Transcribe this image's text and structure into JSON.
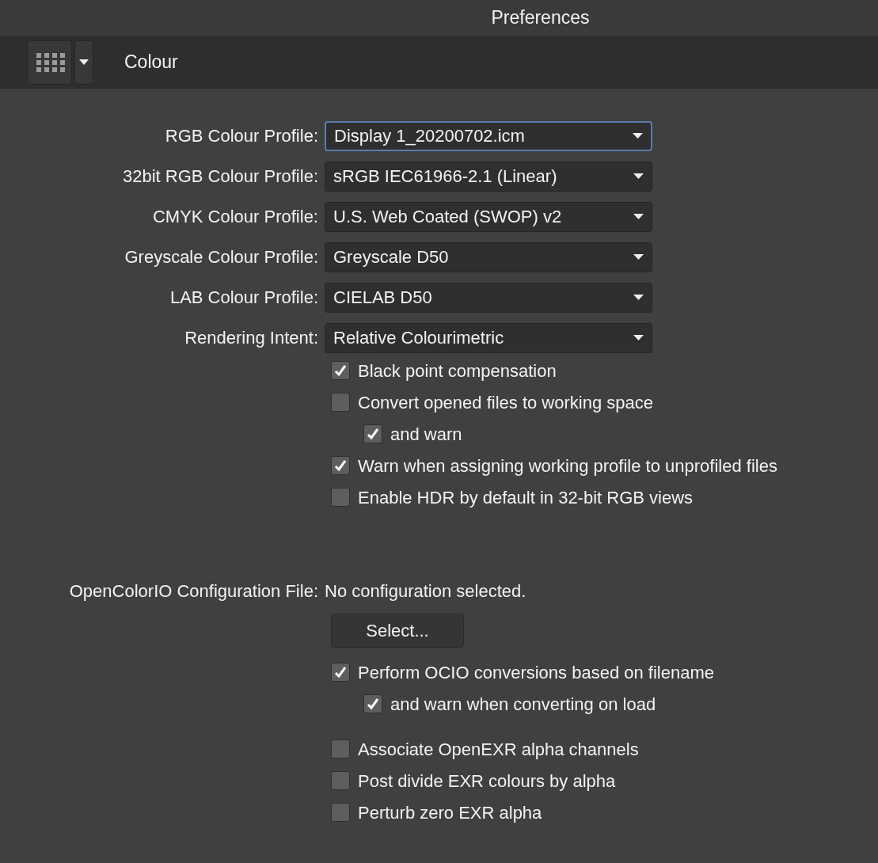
{
  "window": {
    "title": "Preferences"
  },
  "toolbar": {
    "section_title": "Colour"
  },
  "profiles": [
    {
      "label": "RGB Colour Profile:",
      "value": "Display 1_20200702.icm",
      "focused": true
    },
    {
      "label": "32bit RGB Colour Profile:",
      "value": "sRGB IEC61966-2.1 (Linear)",
      "focused": false
    },
    {
      "label": "CMYK Colour Profile:",
      "value": "U.S. Web Coated (SWOP) v2",
      "focused": false
    },
    {
      "label": "Greyscale Colour Profile:",
      "value": "Greyscale D50",
      "focused": false
    },
    {
      "label": "LAB Colour Profile:",
      "value": "CIELAB D50",
      "focused": false
    },
    {
      "label": "Rendering Intent:",
      "value": "Relative Colourimetric",
      "focused": false
    }
  ],
  "options": [
    {
      "label": "Black point compensation",
      "checked": true
    },
    {
      "label": "Convert opened files to working space",
      "checked": false,
      "children": [
        {
          "label": "and warn",
          "checked": true
        }
      ]
    },
    {
      "label": "Warn when assigning working profile to unprofiled files",
      "checked": true
    },
    {
      "label": "Enable HDR by default in 32-bit RGB views",
      "checked": false
    }
  ],
  "ocio": {
    "label": "OpenColorIO Configuration File:",
    "value": "No configuration selected.",
    "button": "Select...",
    "options": [
      {
        "label": "Perform OCIO conversions based on filename",
        "checked": true,
        "children": [
          {
            "label": "and warn when converting on load",
            "checked": true
          }
        ]
      }
    ]
  },
  "exr_options": [
    {
      "label": "Associate OpenEXR alpha channels",
      "checked": false
    },
    {
      "label": "Post divide EXR colours by alpha",
      "checked": false
    },
    {
      "label": "Perturb zero EXR alpha",
      "checked": false
    }
  ]
}
